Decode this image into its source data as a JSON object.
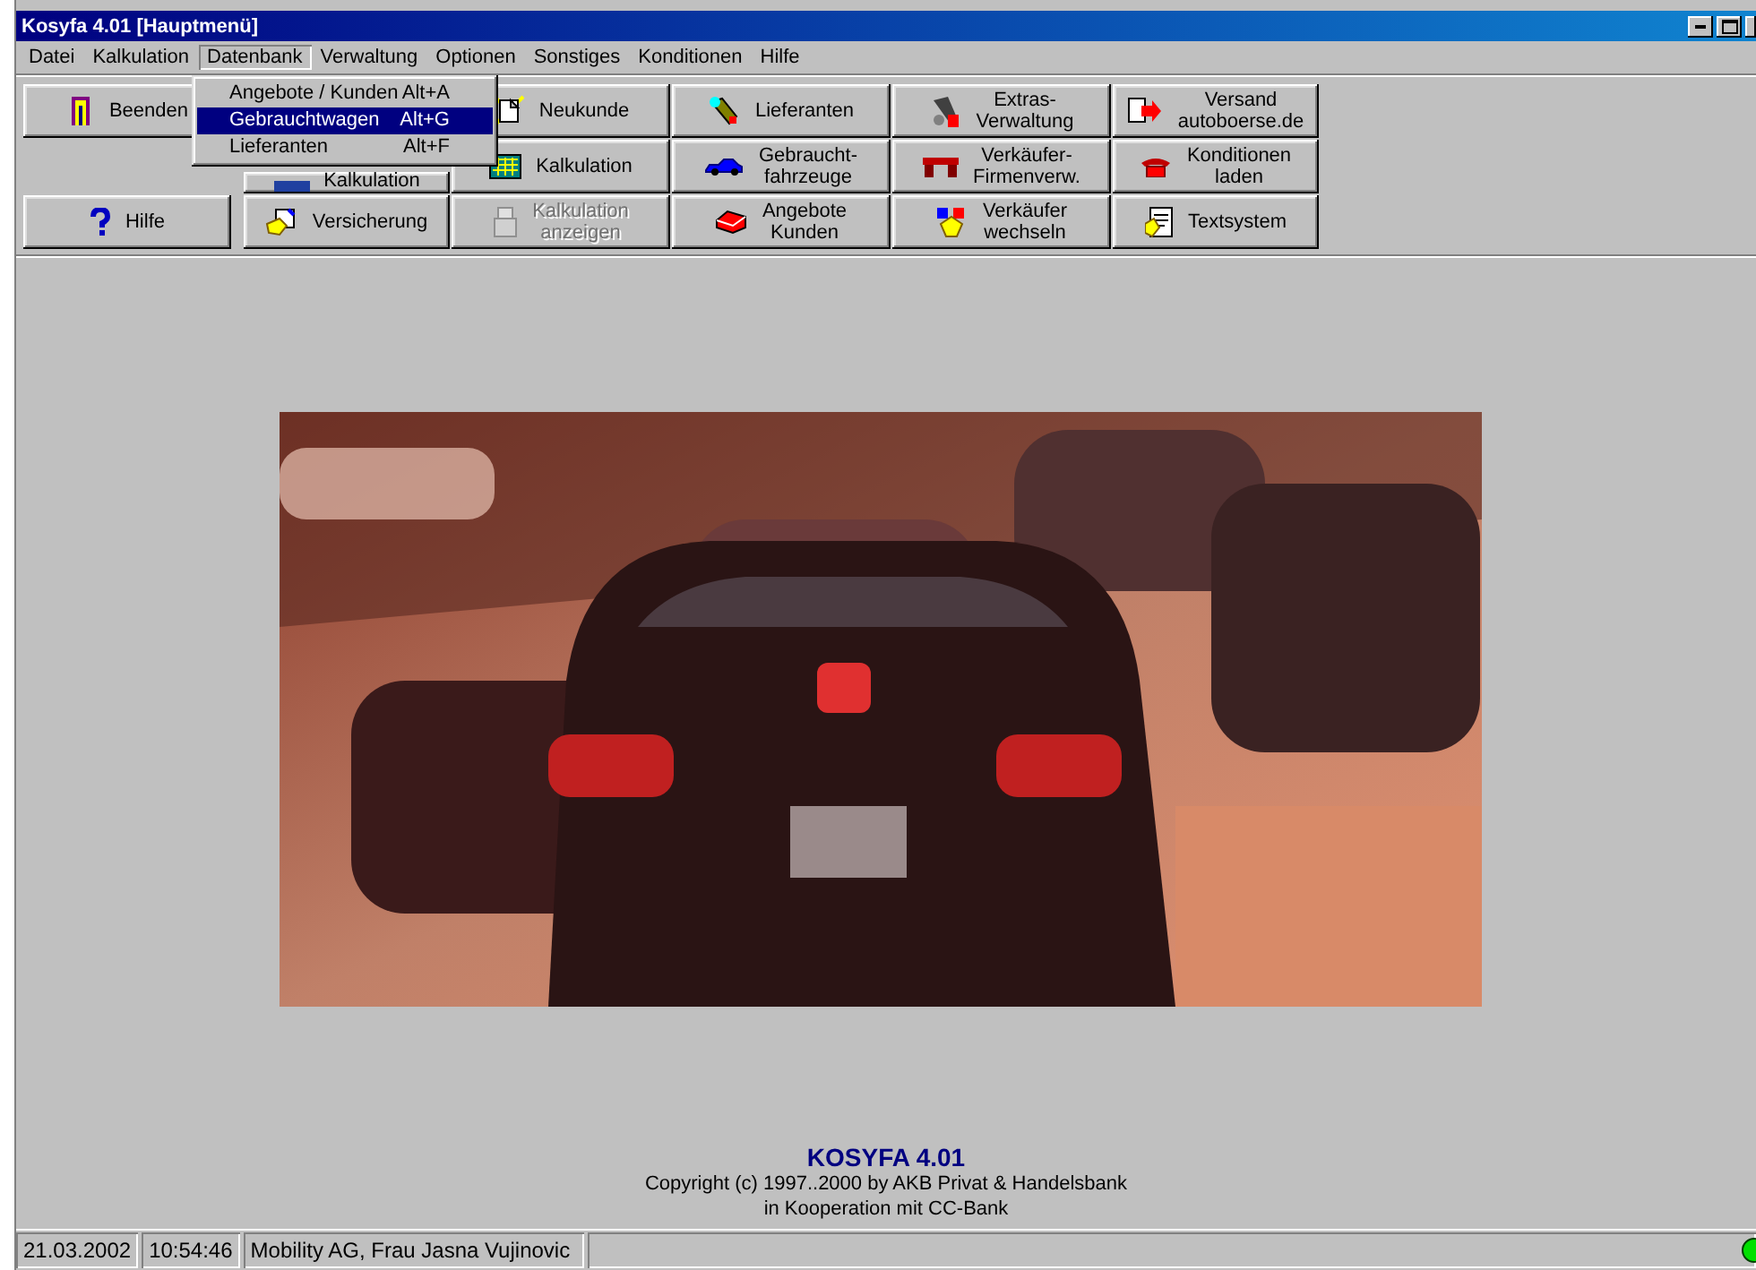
{
  "window": {
    "title": "Kosyfa 4.01 [Hauptmenü]"
  },
  "menu_bar": [
    {
      "label": "Datei",
      "selected": false
    },
    {
      "label": "Kalkulation",
      "selected": false
    },
    {
      "label": "Datenbank",
      "selected": true
    },
    {
      "label": "Verwaltung",
      "selected": false
    },
    {
      "label": "Optionen",
      "selected": false
    },
    {
      "label": "Sonstiges",
      "selected": false
    },
    {
      "label": "Konditionen",
      "selected": false
    },
    {
      "label": "Hilfe",
      "selected": false
    }
  ],
  "dropdown": [
    {
      "label": "Angebote / Kunden",
      "shortcut": "Alt+A",
      "selected": false
    },
    {
      "label": "Gebrauchtwagen",
      "shortcut": "Alt+G",
      "selected": true
    },
    {
      "label": "Lieferanten",
      "shortcut": "Alt+F",
      "selected": false
    }
  ],
  "toolbar": {
    "rows": [
      [
        {
          "lines": [
            "Beenden"
          ],
          "disabled": false
        },
        "",
        {
          "lines": [
            "Neukunde"
          ],
          "disabled": false
        },
        {
          "lines": [
            "Lieferanten"
          ],
          "disabled": false
        },
        {
          "lines": [
            "Extras-",
            "Verwaltung"
          ],
          "disabled": false
        },
        {
          "lines": [
            "Versand",
            "autoboerse.de"
          ],
          "disabled": false
        }
      ],
      [
        "",
        {
          "lines": [
            "Kalkulation"
          ],
          "disabled": false,
          "partly_covered": true
        },
        {
          "lines": [
            "Kalkulation"
          ],
          "disabled": false
        },
        {
          "lines": [
            "Gebraucht-",
            "fahrzeuge"
          ],
          "disabled": false
        },
        {
          "lines": [
            "Verkäufer-",
            "Firmenverw."
          ],
          "disabled": false
        },
        {
          "lines": [
            "Konditionen",
            "laden"
          ],
          "disabled": false
        }
      ],
      [
        {
          "lines": [
            "Hilfe"
          ],
          "disabled": false
        },
        {
          "lines": [
            "Versicherung"
          ],
          "disabled": false
        },
        {
          "lines": [
            "Kalkulation",
            "anzeigen"
          ],
          "disabled": true
        },
        {
          "lines": [
            "Angebote",
            "Kunden"
          ],
          "disabled": false
        },
        {
          "lines": [
            "Verkäufer",
            "wechseln"
          ],
          "disabled": false
        },
        {
          "lines": [
            "Textsystem"
          ],
          "disabled": false
        }
      ]
    ]
  },
  "main": {
    "picture": {
      "kind": "picture"
    },
    "product": "KOSYFA 4.01",
    "copyright": [
      "Copyright (c) 1997..2000 by AKB Privat & Handelsbank",
      "in Kooperation mit CC-Bank"
    ]
  },
  "status_bar": {
    "date": "21.03.2002",
    "time": "10:54:46",
    "user": "Mobility AG, Frau Jasna Vujinovic",
    "online": true
  }
}
